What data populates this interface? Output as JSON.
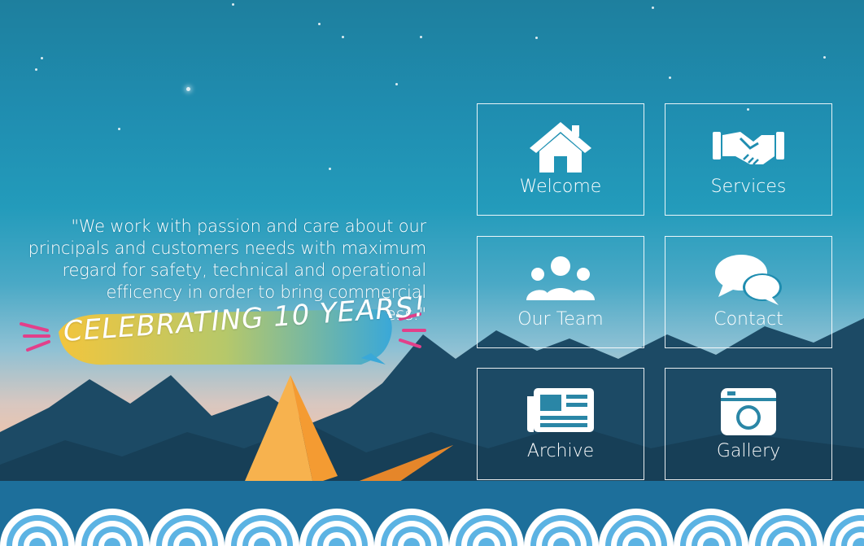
{
  "hero": {
    "quote": "\"We work with passion and care about our principals and customers needs with maximum regard for safety, technical and operational efficency in order to bring commercial success.\"",
    "banner": "CELEBRATING 10 YEARS!"
  },
  "tiles": [
    {
      "label": "Welcome",
      "icon": "home-icon"
    },
    {
      "label": "Services",
      "icon": "handshake-icon"
    },
    {
      "label": "Our Team",
      "icon": "team-icon"
    },
    {
      "label": "Contact",
      "icon": "chat-icon"
    },
    {
      "label": "Archive",
      "icon": "newspaper-icon"
    },
    {
      "label": "Gallery",
      "icon": "camera-icon"
    }
  ],
  "colors": {
    "sky_top": "#1e7f9e",
    "sky_horizon": "#f5bfa3",
    "mountain": "#1b4a64",
    "boat": "#f4a340",
    "banner_start": "#f2c53d",
    "banner_end": "#3aa8d8",
    "accent_pink": "#e2408a"
  }
}
